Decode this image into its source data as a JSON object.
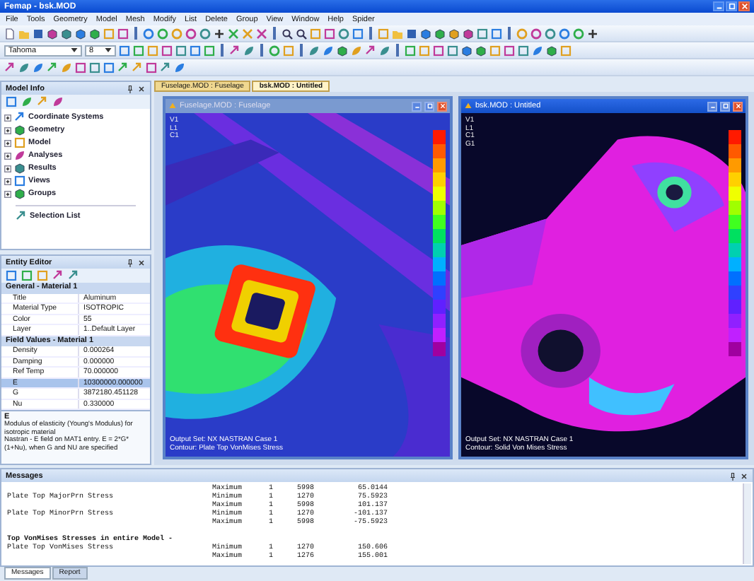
{
  "window": {
    "title": "Femap - bsk.MOD"
  },
  "menu": [
    "File",
    "Tools",
    "Geometry",
    "Model",
    "Mesh",
    "Modify",
    "List",
    "Delete",
    "Group",
    "View",
    "Window",
    "Help",
    "Spider"
  ],
  "format_toolbar": {
    "font": "Tahoma",
    "size": "8"
  },
  "model_info": {
    "title": "Model Info",
    "items": [
      {
        "label": "Coordinate Systems",
        "expanded": false
      },
      {
        "label": "Geometry",
        "expanded": false
      },
      {
        "label": "Model",
        "expanded": false
      },
      {
        "label": "Analyses",
        "expanded": false
      },
      {
        "label": "Results",
        "expanded": false
      },
      {
        "label": "Views",
        "expanded": false
      },
      {
        "label": "Groups",
        "expanded": false
      }
    ],
    "selection_list": "Selection List"
  },
  "entity_editor": {
    "title": "Entity Editor",
    "sections": [
      {
        "title": "General - Material 1",
        "rows": [
          {
            "name": "Title",
            "value": "Aluminum",
            "selected": false
          },
          {
            "name": "Material Type",
            "value": "ISOTROPIC",
            "selected": false
          },
          {
            "name": "Color",
            "value": "55",
            "selected": false
          },
          {
            "name": "Layer",
            "value": "1..Default Layer",
            "selected": false
          }
        ]
      },
      {
        "title": "Field Values - Material 1",
        "rows": [
          {
            "name": "Density",
            "value": "0.000264",
            "selected": false
          },
          {
            "name": "Damping",
            "value": "0.000000",
            "selected": false
          },
          {
            "name": "Ref Temp",
            "value": "70.000000",
            "selected": false
          },
          {
            "name": "E",
            "value": "10300000.000000",
            "selected": true
          },
          {
            "name": "G",
            "value": "3872180.451128",
            "selected": false
          },
          {
            "name": "Nu",
            "value": "0.330000",
            "selected": false
          }
        ]
      }
    ],
    "help_title": "E",
    "help_text": "Modulus of elasticity (Young's Modulus) for isotropic material\nNastran - E field on MAT1 entry.  E = 2*G*(1+Nu), when G and NU are specified"
  },
  "document_tabs": [
    {
      "label": "Fuselage.MOD : Fuselage",
      "selected": false
    },
    {
      "label": "bsk.MOD : Untitled",
      "selected": true
    }
  ],
  "views": [
    {
      "title": "Fuselage.MOD : Fuselage",
      "active": false,
      "kind": "plate",
      "labels": [
        "V1",
        "L1",
        "C1"
      ],
      "output_set": "Output Set: NX NASTRAN Case 1",
      "contour": "Contour: Plate Top VonMises Stress"
    },
    {
      "title": "bsk.MOD : Untitled",
      "active": true,
      "kind": "solid",
      "labels": [
        "V1",
        "L1",
        "C1",
        "G1"
      ],
      "output_set": "Output Set: NX NASTRAN Case 1",
      "contour": "Contour: Solid Von Mises Stress"
    }
  ],
  "messages": {
    "title": "Messages",
    "lines": [
      {
        "type": "Maximum",
        "col_a": "1",
        "col_b": "5998",
        "value": "65.0144"
      },
      {
        "label": "Plate Top MajorPrn Stress",
        "type": "Minimum",
        "col_a": "1",
        "col_b": "1270",
        "value": "75.5923"
      },
      {
        "type": "Maximum",
        "col_a": "1",
        "col_b": "5998",
        "value": "101.137"
      },
      {
        "label": "Plate Top MinorPrn Stress",
        "type": "Minimum",
        "col_a": "1",
        "col_b": "1270",
        "value": "-101.137"
      },
      {
        "type": "Maximum",
        "col_a": "1",
        "col_b": "5998",
        "value": "-75.5923"
      },
      {
        "label": "Top VonMises Stresses in entire Model -",
        "heading": true
      },
      {
        "label": "Plate Top VonMises Stress",
        "type": "Minimum",
        "col_a": "1",
        "col_b": "1270",
        "value": "150.606"
      },
      {
        "type": "Maximum",
        "col_a": "1",
        "col_b": "1276",
        "value": "155.001"
      }
    ]
  },
  "bottom_tabs": [
    {
      "label": "Messages",
      "selected": true
    },
    {
      "label": "Report",
      "selected": false
    }
  ]
}
